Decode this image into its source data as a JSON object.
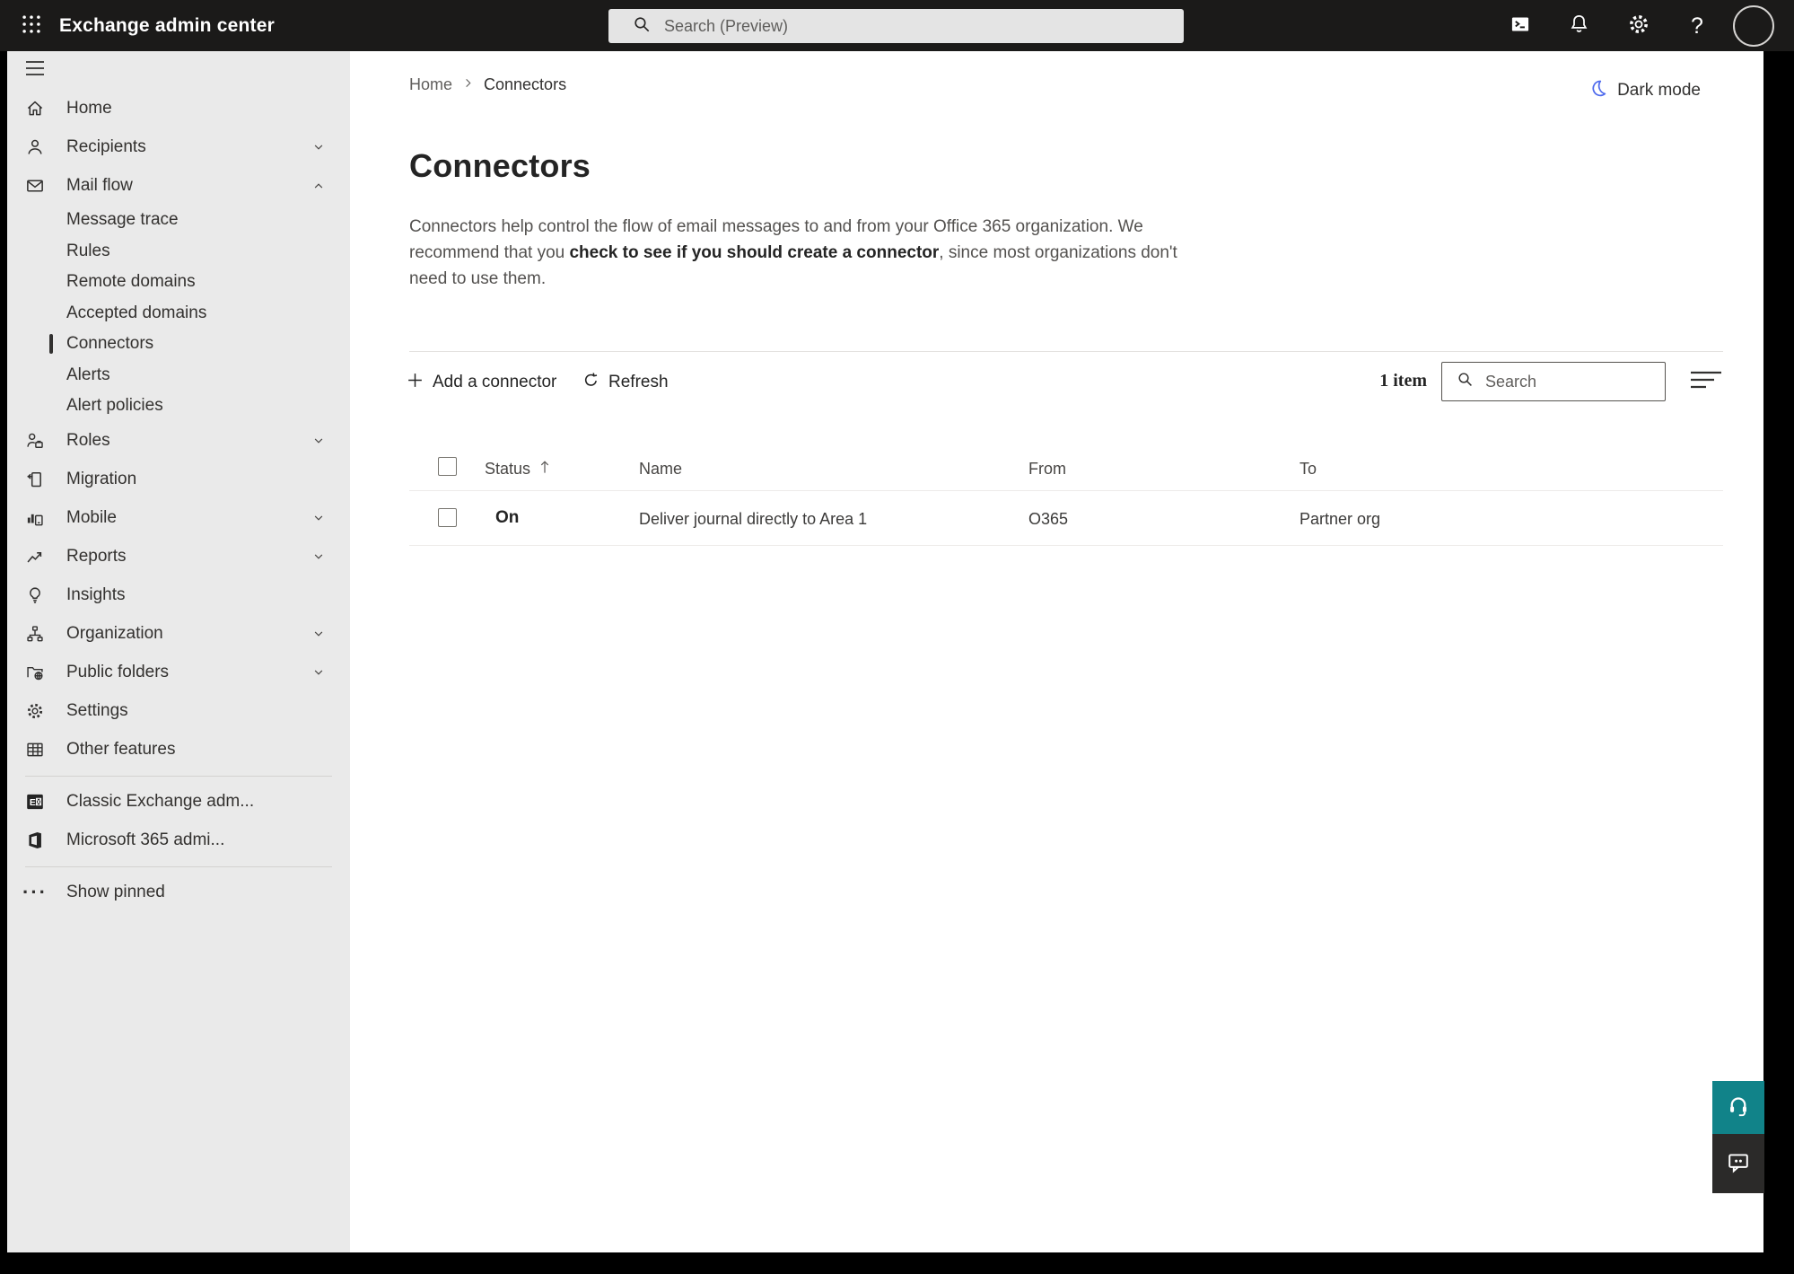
{
  "topbar": {
    "app_title": "Exchange admin center",
    "search_placeholder": "Search (Preview)"
  },
  "sidebar": {
    "items": [
      {
        "label": "Home"
      },
      {
        "label": "Recipients"
      },
      {
        "label": "Mail flow"
      },
      {
        "label": "Message trace"
      },
      {
        "label": "Rules"
      },
      {
        "label": "Remote domains"
      },
      {
        "label": "Accepted domains"
      },
      {
        "label": "Connectors"
      },
      {
        "label": "Alerts"
      },
      {
        "label": "Alert policies"
      },
      {
        "label": "Roles"
      },
      {
        "label": "Migration"
      },
      {
        "label": "Mobile"
      },
      {
        "label": "Reports"
      },
      {
        "label": "Insights"
      },
      {
        "label": "Organization"
      },
      {
        "label": "Public folders"
      },
      {
        "label": "Settings"
      },
      {
        "label": "Other features"
      },
      {
        "label": "Classic Exchange adm..."
      },
      {
        "label": "Microsoft 365 admi..."
      },
      {
        "label": "Show pinned"
      }
    ]
  },
  "breadcrumb": {
    "home": "Home",
    "current": "Connectors"
  },
  "header": {
    "dark_mode_label": "Dark mode"
  },
  "page": {
    "title": "Connectors",
    "description_intro": "Connectors help control the flow of email messages to and from your Office 365 organization. We recommend that you ",
    "description_link": "check to see if you should create a connector",
    "description_outro": ", since most organizations don't need to use them."
  },
  "toolbar": {
    "add_connector_label": "Add a connector",
    "refresh_label": "Refresh",
    "item_count": "1 item",
    "search_placeholder": "Search"
  },
  "table": {
    "columns": {
      "status": "Status",
      "name": "Name",
      "from": "From",
      "to": "To"
    },
    "rows": [
      {
        "status": "On",
        "name": "Deliver journal directly to Area 1",
        "from": "O365",
        "to": "Partner org"
      }
    ]
  },
  "colors": {
    "topbar_bg": "#1b1a19",
    "sidebar_bg": "#eaeaea",
    "moon_blue": "#4f6bed",
    "support_teal": "#118389",
    "text_dark": "#242424",
    "text_gray": "#605e5c"
  }
}
